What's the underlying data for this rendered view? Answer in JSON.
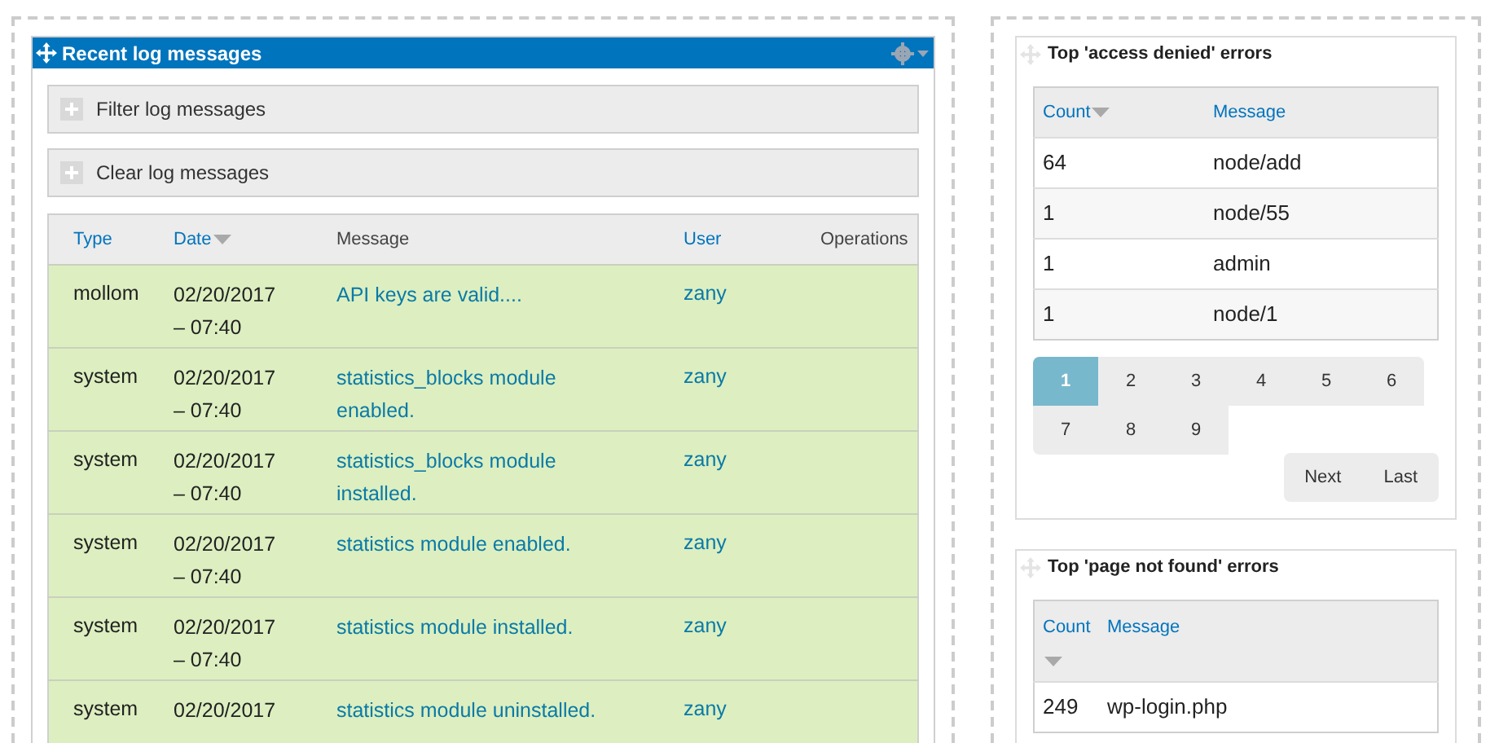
{
  "log_block": {
    "title": "Recent log messages",
    "sections": [
      {
        "label": "Filter log messages",
        "expanded": false
      },
      {
        "label": "Clear log messages",
        "expanded": false
      }
    ],
    "table": {
      "columns": [
        {
          "label": "Type",
          "link": true,
          "sorted": false
        },
        {
          "label": "Date",
          "link": true,
          "sorted": true
        },
        {
          "label": "Message",
          "link": false,
          "sorted": false
        },
        {
          "label": "User",
          "link": true,
          "sorted": false
        },
        {
          "label": "Operations",
          "link": false,
          "sorted": false
        }
      ],
      "rows": [
        {
          "type": "mollom",
          "date": "02/20/2017 – 07:40",
          "message": "API keys are valid....",
          "user": "zany"
        },
        {
          "type": "system",
          "date": "02/20/2017 – 07:40",
          "message": "statistics_blocks module enabled.",
          "user": "zany"
        },
        {
          "type": "system",
          "date": "02/20/2017 – 07:40",
          "message": "statistics_blocks module installed.",
          "user": "zany"
        },
        {
          "type": "system",
          "date": "02/20/2017 – 07:40",
          "message": "statistics module enabled.",
          "user": "zany"
        },
        {
          "type": "system",
          "date": "02/20/2017 – 07:40",
          "message": "statistics module installed.",
          "user": "zany"
        },
        {
          "type": "system",
          "date": "02/20/2017",
          "message": "statistics module uninstalled.",
          "user": "zany"
        }
      ]
    }
  },
  "access_denied": {
    "title": "Top 'access denied' errors",
    "columns": [
      {
        "label": "Count",
        "sorted": true
      },
      {
        "label": "Message",
        "sorted": false
      }
    ],
    "rows": [
      {
        "count": "64",
        "message": "node/add"
      },
      {
        "count": "1",
        "message": "node/55"
      },
      {
        "count": "1",
        "message": "admin"
      },
      {
        "count": "1",
        "message": "node/1"
      }
    ],
    "pages": [
      {
        "label": "1",
        "selected": true
      },
      {
        "label": "2",
        "selected": false
      },
      {
        "label": "3",
        "selected": false
      },
      {
        "label": "4",
        "selected": false
      },
      {
        "label": "5",
        "selected": false
      },
      {
        "label": "6",
        "selected": false
      },
      {
        "label": "7",
        "selected": false
      },
      {
        "label": "8",
        "selected": false
      },
      {
        "label": "9",
        "selected": false
      }
    ],
    "nav": [
      "Next",
      "Last"
    ]
  },
  "not_found": {
    "title": "Top 'page not found' errors",
    "columns": [
      {
        "label": "Count",
        "sorted": true
      },
      {
        "label": "Message",
        "sorted": false
      }
    ],
    "rows": [
      {
        "count": "249",
        "message": "wp-login.php"
      }
    ]
  }
}
